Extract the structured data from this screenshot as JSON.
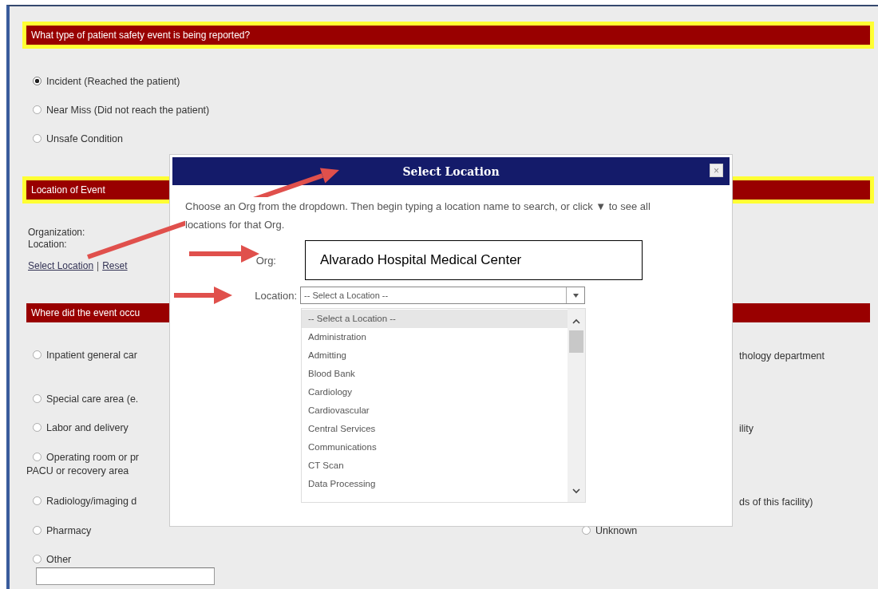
{
  "event_type": {
    "title": "What type of patient safety event is being reported?",
    "options": [
      {
        "label": "Incident (Reached the patient)",
        "selected": true
      },
      {
        "label": "Near Miss (Did not reach the patient)",
        "selected": false
      },
      {
        "label": "Unsafe Condition",
        "selected": false
      }
    ]
  },
  "location_of_event": {
    "title": "Location of Event",
    "fields": [
      "Organization:",
      "Location:"
    ],
    "links": [
      "Select Location",
      "Reset"
    ],
    "separator": "|"
  },
  "where": {
    "title": "Where did the event occu",
    "rows": [
      {
        "left": {
          "lines": [
            "Inpatient general car"
          ],
          "selected": false
        },
        "right_fragment": "thology department"
      },
      {
        "left": {
          "lines": [
            "Special care area (e."
          ],
          "selected": false
        }
      },
      {
        "left": {
          "lines": [
            "Labor and delivery"
          ],
          "selected": false
        },
        "right_fragment": "ility"
      },
      {
        "left": {
          "lines": [
            "Operating room or pr",
            "PACU or recovery area"
          ],
          "selected": false
        }
      },
      {
        "left": {
          "lines": [
            "Radiology/imaging d"
          ],
          "selected": false
        },
        "right_fragment": "ds of this facility)"
      },
      {
        "left": {
          "lines": [
            "Pharmacy"
          ],
          "selected": false
        },
        "right_option": {
          "label": "Unknown",
          "selected": false
        }
      },
      {
        "left": {
          "lines": [
            "Other"
          ],
          "selected": false
        }
      }
    ]
  },
  "dialog": {
    "title": "Select Location",
    "close": "×",
    "instructions": "Choose an Org from the dropdown. Then begin typing a location name to search, or click ▼ to see all locations for that Org.",
    "org_label": "Org:",
    "org_value": "Alvarado Hospital Medical Center",
    "location_label": "Location:",
    "location_value": "-- Select a Location --",
    "options": [
      {
        "label": "-- Select a Location --",
        "selected": true
      },
      {
        "label": "Administration",
        "selected": false
      },
      {
        "label": "Admitting",
        "selected": false
      },
      {
        "label": "Blood Bank",
        "selected": false
      },
      {
        "label": "Cardiology",
        "selected": false
      },
      {
        "label": "Cardiovascular",
        "selected": false
      },
      {
        "label": "Central Services",
        "selected": false
      },
      {
        "label": "Communications",
        "selected": false
      },
      {
        "label": "CT Scan",
        "selected": false
      },
      {
        "label": "Data Processing",
        "selected": false
      }
    ]
  }
}
